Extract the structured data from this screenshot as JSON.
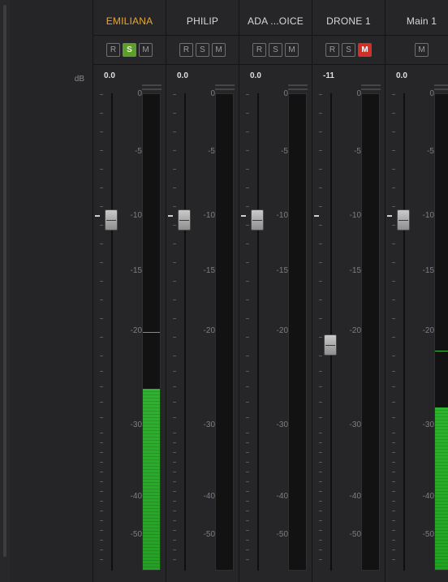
{
  "unit_label": "dB",
  "scale_labels": [
    "0",
    "-5",
    "-10",
    "-15",
    "-20",
    "-30",
    "-40",
    "-50"
  ],
  "strips": [
    {
      "name": "EMILIANA",
      "selected": true,
      "buttons": [
        {
          "label": "R",
          "state": "off"
        },
        {
          "label": "S",
          "state": "solo"
        },
        {
          "label": "M",
          "state": "off"
        }
      ],
      "level": "0.0",
      "fader_db": 0,
      "meter_db": -26,
      "peak_db": -20
    },
    {
      "name": "PHILIP",
      "selected": false,
      "buttons": [
        {
          "label": "R",
          "state": "off"
        },
        {
          "label": "S",
          "state": "off"
        },
        {
          "label": "M",
          "state": "off"
        }
      ],
      "level": "0.0",
      "fader_db": 0,
      "meter_db": null,
      "peak_db": null
    },
    {
      "name": "ADA ...OICE",
      "selected": false,
      "buttons": [
        {
          "label": "R",
          "state": "off"
        },
        {
          "label": "S",
          "state": "off"
        },
        {
          "label": "M",
          "state": "off"
        }
      ],
      "level": "0.0",
      "fader_db": 0,
      "meter_db": null,
      "peak_db": null
    },
    {
      "name": "DRONE 1",
      "selected": false,
      "buttons": [
        {
          "label": "R",
          "state": "off"
        },
        {
          "label": "S",
          "state": "off"
        },
        {
          "label": "M",
          "state": "mute"
        }
      ],
      "level": "-11",
      "fader_db": -11,
      "meter_db": null,
      "peak_db": null
    },
    {
      "name": "Main 1",
      "selected": false,
      "buttons": [
        {
          "label": "M",
          "state": "off"
        }
      ],
      "level": "0.0",
      "fader_db": 0,
      "meter_db": -28,
      "peak_db": -22
    }
  ],
  "colors": {
    "selected_name": "#e8a833",
    "solo_on": "#5e9c2c",
    "mute_on": "#cf3027",
    "meter_green": "#2fb22f"
  }
}
